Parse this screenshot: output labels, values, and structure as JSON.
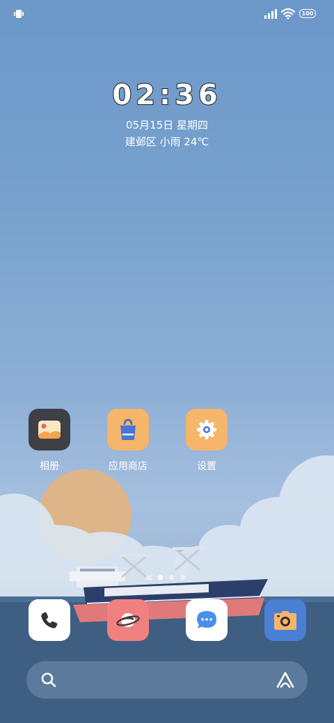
{
  "status_bar": {
    "battery_level": "100",
    "icons": [
      "vibrate-icon",
      "signal-icon",
      "wifi-icon",
      "battery-icon"
    ]
  },
  "clock_widget": {
    "time": "02:36",
    "date": "05月15日 星期四",
    "weather": "建邺区 小雨 24℃"
  },
  "home_apps": [
    {
      "label": "相册",
      "icon": "gallery-icon",
      "color": "#3f3f46"
    },
    {
      "label": "应用商店",
      "icon": "shopping-bag-icon",
      "color": "#f5b56b"
    },
    {
      "label": "设置",
      "icon": "gear-icon",
      "color": "#f5b56b"
    }
  ],
  "page_indicator": {
    "pages": 3,
    "current": 1
  },
  "dock": [
    {
      "icon": "phone-icon",
      "color": "#ffffff"
    },
    {
      "icon": "browser-planet-icon",
      "color": "#f08080"
    },
    {
      "icon": "message-icon",
      "color": "#ffffff"
    },
    {
      "icon": "camera-icon",
      "color": "#4a7fd6"
    }
  ],
  "search_bar": {
    "icons": [
      "search-icon",
      "assistant-icon"
    ]
  }
}
